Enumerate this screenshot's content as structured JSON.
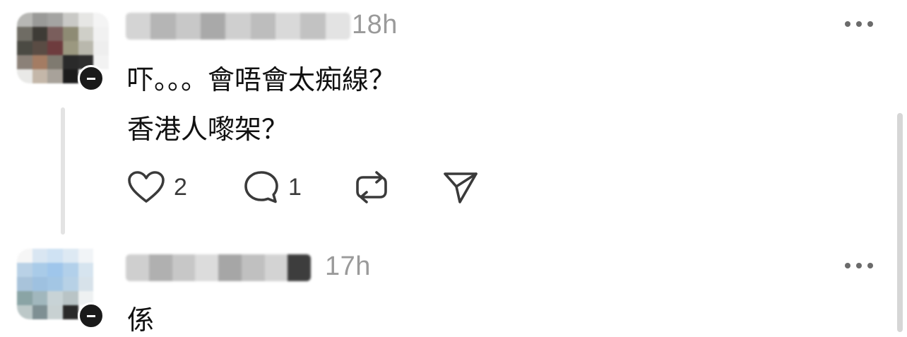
{
  "comments": [
    {
      "username_censored": true,
      "timestamp": "18h",
      "lines": [
        "吓。。。會唔會太痴線？",
        "香港人嚟架？"
      ],
      "like_count": "2",
      "reply_count": "1",
      "icons": {
        "more": "more-horizontal-icon",
        "like": "heart-outline-icon",
        "reply": "speech-bubble-icon",
        "repost": "repost-icon",
        "share": "send-icon"
      }
    },
    {
      "username_censored": true,
      "timestamp": "17h",
      "lines": [
        "係"
      ],
      "icons": {
        "more": "more-horizontal-icon"
      }
    }
  ],
  "colors": {
    "text": "#111111",
    "muted": "#9a9a9a",
    "icon": "#3a3a3a",
    "thread_line": "#e3e3e3",
    "background": "#ffffff"
  }
}
